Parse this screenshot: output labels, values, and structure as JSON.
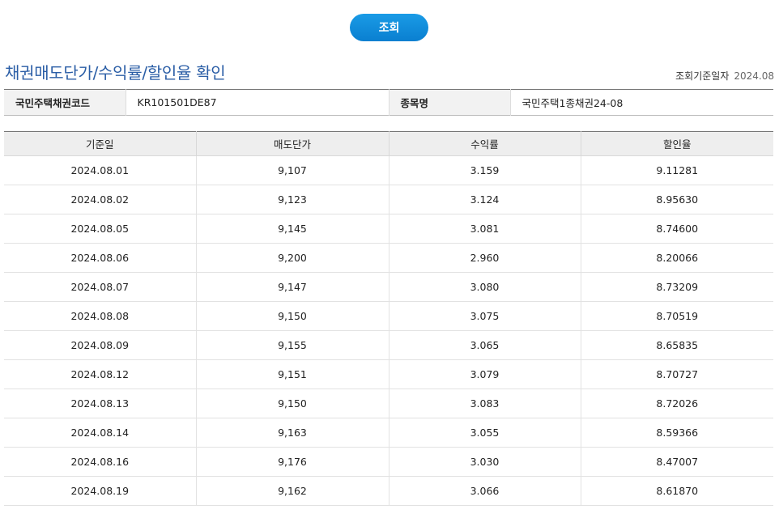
{
  "search_button": {
    "label": "조회"
  },
  "page_title": "채권매도단가/수익률/할인율 확인",
  "reference_date": {
    "label": "조회기준일자",
    "value": "2024.08"
  },
  "bond_info": {
    "code_label": "국민주택채권코드",
    "code_value": "KR101501DE87",
    "name_label": "종목명",
    "name_value": "국민주택1종채권24-08"
  },
  "table": {
    "headers": [
      "기준일",
      "매도단가",
      "수익률",
      "할인율"
    ],
    "rows": [
      [
        "2024.08.01",
        "9,107",
        "3.159",
        "9.11281"
      ],
      [
        "2024.08.02",
        "9,123",
        "3.124",
        "8.95630"
      ],
      [
        "2024.08.05",
        "9,145",
        "3.081",
        "8.74600"
      ],
      [
        "2024.08.06",
        "9,200",
        "2.960",
        "8.20066"
      ],
      [
        "2024.08.07",
        "9,147",
        "3.080",
        "8.73209"
      ],
      [
        "2024.08.08",
        "9,150",
        "3.075",
        "8.70519"
      ],
      [
        "2024.08.09",
        "9,155",
        "3.065",
        "8.65835"
      ],
      [
        "2024.08.12",
        "9,151",
        "3.079",
        "8.70727"
      ],
      [
        "2024.08.13",
        "9,150",
        "3.083",
        "8.72026"
      ],
      [
        "2024.08.14",
        "9,163",
        "3.055",
        "8.59366"
      ],
      [
        "2024.08.16",
        "9,176",
        "3.030",
        "8.47007"
      ],
      [
        "2024.08.19",
        "9,162",
        "3.066",
        "8.61870"
      ]
    ]
  }
}
